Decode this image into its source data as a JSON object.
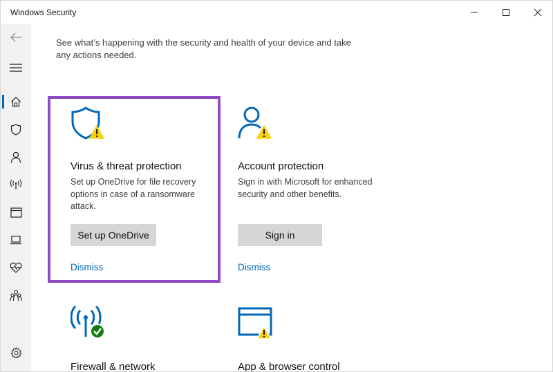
{
  "window": {
    "title": "Windows Security"
  },
  "intro": {
    "text": "See what’s happening with the security and health of your device and take any actions needed."
  },
  "sidebar": {
    "items": [
      {
        "name": "back",
        "icon": "back-arrow-icon"
      },
      {
        "name": "menu",
        "icon": "hamburger-menu-icon"
      },
      {
        "name": "home",
        "icon": "home-icon",
        "active": true
      },
      {
        "name": "virus-threat-protection",
        "icon": "shield-icon"
      },
      {
        "name": "account-protection",
        "icon": "person-icon"
      },
      {
        "name": "firewall-network-protection",
        "icon": "wifi-signal-icon"
      },
      {
        "name": "app-browser-control",
        "icon": "browser-window-icon"
      },
      {
        "name": "device-security",
        "icon": "laptop-icon"
      },
      {
        "name": "device-performance-health",
        "icon": "heart-pulse-icon"
      },
      {
        "name": "family-options",
        "icon": "family-icon"
      },
      {
        "name": "settings",
        "icon": "gear-icon"
      }
    ]
  },
  "cards": {
    "virus": {
      "title": "Virus & threat protection",
      "description": "Set up OneDrive for file recovery options in case of a ransomware attack.",
      "button": "Set up OneDrive",
      "link": "Dismiss",
      "status": "warning",
      "icon": "shield-warning-icon"
    },
    "account": {
      "title": "Account protection",
      "description": "Sign in with Microsoft for enhanced security and other benefits.",
      "button": "Sign in",
      "link": "Dismiss",
      "status": "warning",
      "icon": "person-warning-icon"
    },
    "firewall": {
      "title": "Firewall & network",
      "status": "ok",
      "icon": "wifi-check-icon"
    },
    "app": {
      "title": "App & browser control",
      "status": "warning",
      "icon": "browser-warning-icon"
    }
  },
  "colors": {
    "accent_blue": "#0067b8",
    "warning_yellow": "#f8d00e",
    "ok_green": "#107c10",
    "highlight_purple": "#8f4bc4",
    "button_gray": "#d6d6d6",
    "sidebar_bg": "#f2f2f2"
  }
}
